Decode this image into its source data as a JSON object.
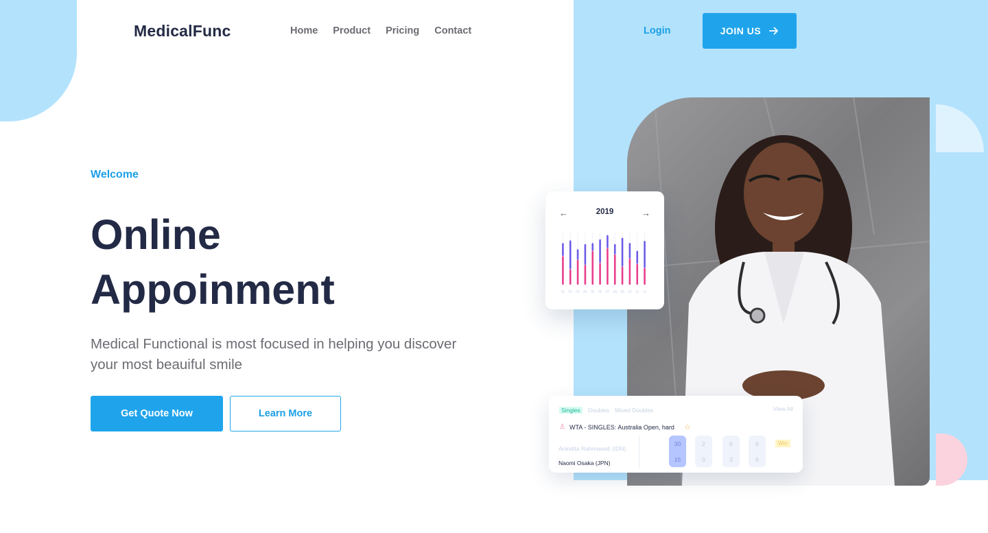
{
  "brand": {
    "logo": "MedicalFunc"
  },
  "nav": {
    "items": [
      "Home",
      "Product",
      "Pricing",
      "Contact"
    ]
  },
  "header": {
    "login": "Login",
    "join": "JOIN US"
  },
  "hero": {
    "welcome": "Welcome",
    "title_line1": "Online",
    "title_line2": "Appoinment",
    "subtitle": "Medical Functional is most focused in helping you discover your most beauiful smile",
    "cta_primary": "Get Quote Now",
    "cta_secondary": "Learn More"
  },
  "chart_card": {
    "year": "2019",
    "prev": "←",
    "next": "→"
  },
  "chart_data": {
    "type": "bar",
    "title": "2019",
    "categories": [
      "01",
      "02",
      "03",
      "04",
      "05",
      "06",
      "07",
      "08",
      "09",
      "10",
      "11",
      "12"
    ],
    "series": [
      {
        "name": "",
        "color": "#e83e8c",
        "values": [
          55,
          30,
          48,
          38,
          65,
          42,
          70,
          58,
          35,
          50,
          40,
          32
        ]
      },
      {
        "name": "",
        "color": "#6c5ce7",
        "values": [
          25,
          55,
          20,
          40,
          15,
          45,
          25,
          20,
          55,
          30,
          25,
          52
        ]
      }
    ],
    "ylim": [
      0,
      100
    ],
    "grid": true
  },
  "score_card": {
    "tabs": [
      "Singles",
      "Doubles",
      "Mixed Doubles"
    ],
    "view_all": "View All",
    "match": "WTA - SINGLES: Australia Open, hard",
    "player1": "Anindita Rahmawati (IDN)",
    "player2": "Naomi Osaka (JPN)",
    "sets": [
      {
        "top": "30",
        "bottom": "15"
      },
      {
        "top": "2",
        "bottom": "0"
      },
      {
        "top": "6",
        "bottom": "3"
      },
      {
        "top": "6",
        "bottom": "6"
      }
    ],
    "win": "Win"
  },
  "colors": {
    "accent": "#1fa4ec",
    "navy": "#232a45",
    "light_blue": "#b3e2fc",
    "pink": "#fbd3de"
  }
}
